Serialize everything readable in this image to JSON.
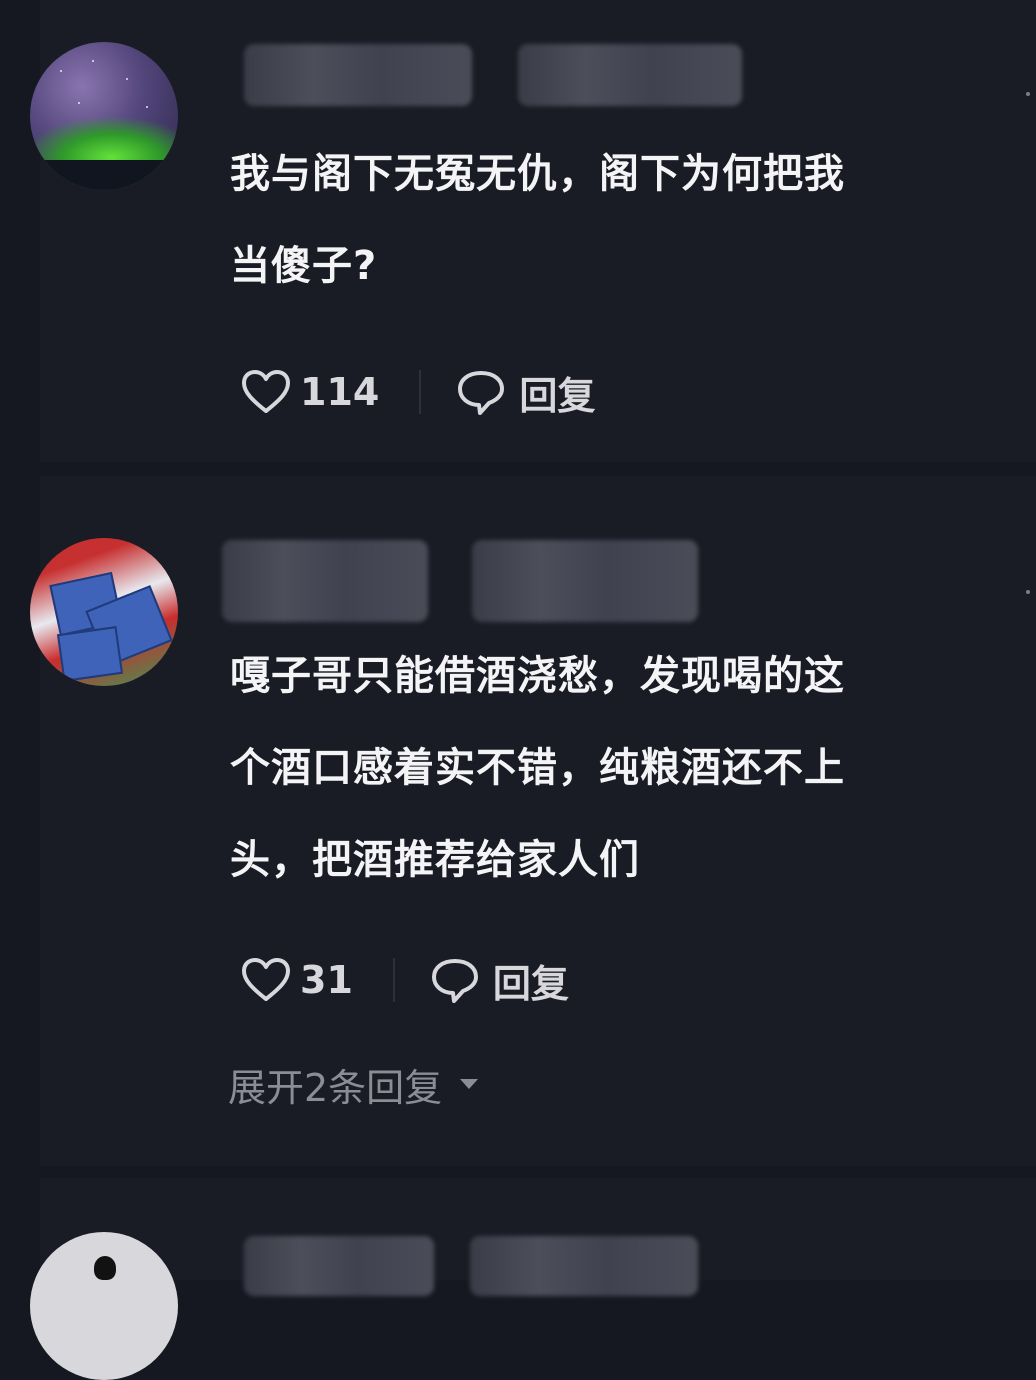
{
  "comments": [
    {
      "text": "我与阁下无冤无仇，阁下为何把我\n当傻子?",
      "likes": "114",
      "reply_label": "回复"
    },
    {
      "text": "嘎子哥只能借酒浇愁，发现喝的这\n个酒口感着实不错，纯粮酒还不上\n头，把酒推荐给家人们",
      "likes": "31",
      "reply_label": "回复",
      "expand_label": "展开2条回复"
    }
  ],
  "icons": {
    "like": "heart-outline-icon",
    "reply": "speech-bubble-icon",
    "expand": "caret-down-icon"
  },
  "colors": {
    "background": "#161821",
    "text": "#f4f4f6",
    "muted": "#8b8d96"
  }
}
